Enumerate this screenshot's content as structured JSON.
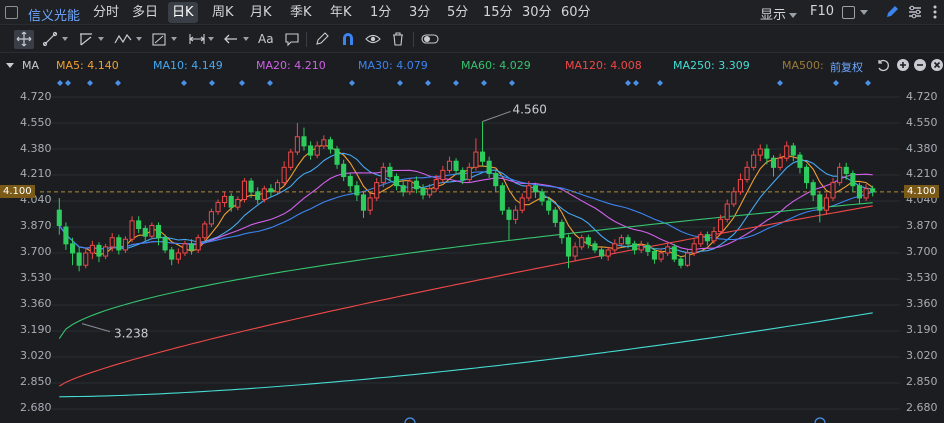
{
  "header": {
    "stock_name": "信义光能",
    "periods": [
      "分时",
      "多日",
      "日K",
      "周K",
      "月K",
      "季K",
      "年K",
      "1分",
      "3分",
      "5分",
      "15分",
      "30分",
      "60分"
    ],
    "active_period": "日K",
    "display_label": "显示",
    "f10_label": "F10"
  },
  "toolbar": {
    "text_tool_label": "Aa",
    "tools": [
      "move-icon",
      "line-icon",
      "polyline-icon",
      "wave-icon",
      "fib-icon",
      "range-icon",
      "arrow-icon",
      "text-icon",
      "comment-icon",
      "pen-icon",
      "magnet-icon",
      "eye-icon",
      "trash-icon",
      "toggle-icon"
    ]
  },
  "ma_row": {
    "toggle_label": "MA",
    "adjust_label": "前复权",
    "items": [
      {
        "text": "MA5: 4.140",
        "color": "#f0a030"
      },
      {
        "text": "MA10: 4.149",
        "color": "#46a8f0"
      },
      {
        "text": "MA20: 4.210",
        "color": "#d060e8"
      },
      {
        "text": "MA30: 4.079",
        "color": "#3c84f0"
      },
      {
        "text": "MA60: 4.029",
        "color": "#36c46e"
      },
      {
        "text": "MA120: 4.008",
        "color": "#f04848"
      },
      {
        "text": "MA250: 3.309",
        "color": "#46dcd4"
      },
      {
        "text": "MA500: ",
        "color": "#9a7a3a"
      }
    ]
  },
  "axis": {
    "ticks": [
      "4.720",
      "4.550",
      "4.380",
      "4.210",
      "4.040",
      "3.870",
      "3.700",
      "3.530",
      "3.360",
      "3.190",
      "3.020",
      "2.850",
      "2.680"
    ],
    "current_price": "4.100"
  },
  "chart_data": {
    "type": "candlestick",
    "ylim": [
      2.68,
      4.72
    ],
    "current_price": 4.1,
    "annotations": [
      {
        "label": "4.560",
        "value": 4.56
      },
      {
        "label": "3.238",
        "value": 3.238
      }
    ],
    "candles": [
      [
        3.98,
        3.88,
        4.06,
        3.82
      ],
      [
        3.87,
        3.76,
        3.9,
        3.72
      ],
      [
        3.76,
        3.7,
        3.8,
        3.62
      ],
      [
        3.7,
        3.62,
        3.74,
        3.58
      ],
      [
        3.62,
        3.7,
        3.73,
        3.6
      ],
      [
        3.7,
        3.75,
        3.78,
        3.66
      ],
      [
        3.75,
        3.68,
        3.77,
        3.64
      ],
      [
        3.68,
        3.74,
        3.76,
        3.66
      ],
      [
        3.74,
        3.8,
        3.83,
        3.71
      ],
      [
        3.8,
        3.72,
        3.82,
        3.69
      ],
      [
        3.72,
        3.79,
        3.81,
        3.7
      ],
      [
        3.79,
        3.91,
        3.94,
        3.77
      ],
      [
        3.91,
        3.86,
        3.94,
        3.83
      ],
      [
        3.86,
        3.81,
        3.88,
        3.78
      ],
      [
        3.81,
        3.88,
        3.9,
        3.79
      ],
      [
        3.88,
        3.8,
        3.9,
        3.75
      ],
      [
        3.8,
        3.72,
        3.82,
        3.7
      ],
      [
        3.72,
        3.66,
        3.74,
        3.62
      ],
      [
        3.66,
        3.7,
        3.73,
        3.63
      ],
      [
        3.7,
        3.76,
        3.78,
        3.68
      ],
      [
        3.76,
        3.72,
        3.79,
        3.69
      ],
      [
        3.72,
        3.8,
        3.82,
        3.7
      ],
      [
        3.8,
        3.89,
        3.91,
        3.78
      ],
      [
        3.89,
        3.97,
        3.99,
        3.87
      ],
      [
        3.97,
        4.03,
        4.05,
        3.95
      ],
      [
        4.03,
        4.07,
        4.1,
        4.0
      ],
      [
        4.07,
        4.0,
        4.09,
        3.97
      ],
      [
        4.0,
        4.05,
        4.07,
        3.98
      ],
      [
        4.05,
        4.17,
        4.19,
        4.03
      ],
      [
        4.17,
        4.1,
        4.19,
        4.06
      ],
      [
        4.1,
        4.05,
        4.13,
        4.02
      ],
      [
        4.05,
        4.12,
        4.14,
        4.03
      ],
      [
        4.12,
        4.1,
        4.15,
        4.07
      ],
      [
        4.1,
        4.16,
        4.18,
        4.08
      ],
      [
        4.16,
        4.26,
        4.3,
        4.14
      ],
      [
        4.26,
        4.36,
        4.38,
        4.24
      ],
      [
        4.36,
        4.46,
        4.55,
        4.34
      ],
      [
        4.46,
        4.4,
        4.52,
        4.37
      ],
      [
        4.4,
        4.34,
        4.43,
        4.31
      ],
      [
        4.34,
        4.4,
        4.43,
        4.32
      ],
      [
        4.4,
        4.44,
        4.47,
        4.38
      ],
      [
        4.44,
        4.38,
        4.46,
        4.35
      ],
      [
        4.38,
        4.28,
        4.4,
        4.25
      ],
      [
        4.28,
        4.2,
        4.31,
        4.17
      ],
      [
        4.2,
        4.14,
        4.22,
        4.1
      ],
      [
        4.14,
        4.08,
        4.17,
        4.04
      ],
      [
        4.08,
        3.98,
        4.1,
        3.93
      ],
      [
        3.98,
        4.06,
        4.09,
        3.95
      ],
      [
        4.06,
        4.16,
        4.19,
        4.04
      ],
      [
        4.16,
        4.26,
        4.29,
        4.13
      ],
      [
        4.26,
        4.2,
        4.29,
        4.17
      ],
      [
        4.2,
        4.14,
        4.22,
        4.11
      ],
      [
        4.14,
        4.1,
        4.17,
        4.07
      ],
      [
        4.1,
        4.17,
        4.19,
        4.08
      ],
      [
        4.17,
        4.12,
        4.2,
        4.09
      ],
      [
        4.12,
        4.08,
        4.15,
        4.05
      ],
      [
        4.08,
        4.12,
        4.15,
        4.06
      ],
      [
        4.12,
        4.18,
        4.21,
        4.1
      ],
      [
        4.18,
        4.24,
        4.27,
        4.16
      ],
      [
        4.24,
        4.3,
        4.33,
        4.22
      ],
      [
        4.3,
        4.24,
        4.32,
        4.21
      ],
      [
        4.24,
        4.18,
        4.26,
        4.15
      ],
      [
        4.18,
        4.26,
        4.29,
        4.16
      ],
      [
        4.26,
        4.36,
        4.45,
        4.24
      ],
      [
        4.36,
        4.3,
        4.56,
        4.27
      ],
      [
        4.3,
        4.22,
        4.33,
        4.19
      ],
      [
        4.22,
        4.14,
        4.24,
        4.1
      ],
      [
        4.14,
        3.98,
        4.16,
        3.95
      ],
      [
        3.98,
        3.92,
        4.0,
        3.78
      ],
      [
        3.92,
        3.98,
        4.01,
        3.89
      ],
      [
        3.98,
        4.06,
        4.09,
        3.96
      ],
      [
        4.06,
        4.14,
        4.17,
        4.04
      ],
      [
        4.14,
        4.1,
        4.16,
        4.06
      ],
      [
        4.1,
        4.04,
        4.12,
        4.01
      ],
      [
        4.04,
        3.98,
        4.06,
        3.95
      ],
      [
        3.98,
        3.9,
        4.0,
        3.87
      ],
      [
        3.9,
        3.8,
        3.92,
        3.76
      ],
      [
        3.8,
        3.68,
        3.82,
        3.6
      ],
      [
        3.68,
        3.74,
        3.77,
        3.65
      ],
      [
        3.74,
        3.8,
        3.82,
        3.72
      ],
      [
        3.8,
        3.76,
        3.82,
        3.73
      ],
      [
        3.76,
        3.72,
        3.78,
        3.7
      ],
      [
        3.72,
        3.68,
        3.74,
        3.66
      ],
      [
        3.68,
        3.72,
        3.74,
        3.65
      ],
      [
        3.72,
        3.76,
        3.79,
        3.7
      ],
      [
        3.76,
        3.8,
        3.82,
        3.74
      ],
      [
        3.8,
        3.76,
        3.82,
        3.73
      ],
      [
        3.76,
        3.72,
        3.78,
        3.69
      ],
      [
        3.72,
        3.75,
        3.78,
        3.7
      ],
      [
        3.75,
        3.71,
        3.77,
        3.68
      ],
      [
        3.71,
        3.66,
        3.73,
        3.63
      ],
      [
        3.66,
        3.7,
        3.73,
        3.64
      ],
      [
        3.7,
        3.74,
        3.76,
        3.68
      ],
      [
        3.74,
        3.66,
        3.76,
        3.64
      ],
      [
        3.66,
        3.62,
        3.68,
        3.6
      ],
      [
        3.62,
        3.7,
        3.73,
        3.61
      ],
      [
        3.7,
        3.76,
        3.79,
        3.68
      ],
      [
        3.76,
        3.82,
        3.84,
        3.74
      ],
      [
        3.82,
        3.78,
        3.84,
        3.75
      ],
      [
        3.78,
        3.84,
        3.87,
        3.76
      ],
      [
        3.84,
        3.92,
        3.95,
        3.82
      ],
      [
        3.92,
        4.02,
        4.05,
        3.9
      ],
      [
        4.02,
        4.1,
        4.13,
        4.0
      ],
      [
        4.1,
        4.18,
        4.22,
        4.08
      ],
      [
        4.18,
        4.26,
        4.3,
        4.16
      ],
      [
        4.26,
        4.34,
        4.37,
        4.24
      ],
      [
        4.34,
        4.38,
        4.41,
        4.3
      ],
      [
        4.38,
        4.32,
        4.41,
        4.28
      ],
      [
        4.32,
        4.26,
        4.34,
        4.2
      ],
      [
        4.26,
        4.32,
        4.35,
        4.24
      ],
      [
        4.32,
        4.4,
        4.43,
        4.3
      ],
      [
        4.4,
        4.34,
        4.42,
        4.3
      ],
      [
        4.34,
        4.26,
        4.36,
        4.22
      ],
      [
        4.26,
        4.16,
        4.28,
        4.12
      ],
      [
        4.16,
        4.08,
        4.18,
        4.04
      ],
      [
        4.08,
        3.98,
        4.1,
        3.9
      ],
      [
        3.98,
        4.06,
        4.09,
        3.95
      ],
      [
        4.06,
        4.16,
        4.19,
        4.04
      ],
      [
        4.16,
        4.26,
        4.29,
        4.14
      ],
      [
        4.26,
        4.22,
        4.29,
        4.18
      ],
      [
        4.22,
        4.14,
        4.24,
        4.1
      ],
      [
        4.14,
        4.06,
        4.16,
        4.02
      ],
      [
        4.06,
        4.12,
        4.15,
        4.04
      ],
      [
        4.12,
        4.1,
        4.14,
        4.07
      ]
    ]
  }
}
